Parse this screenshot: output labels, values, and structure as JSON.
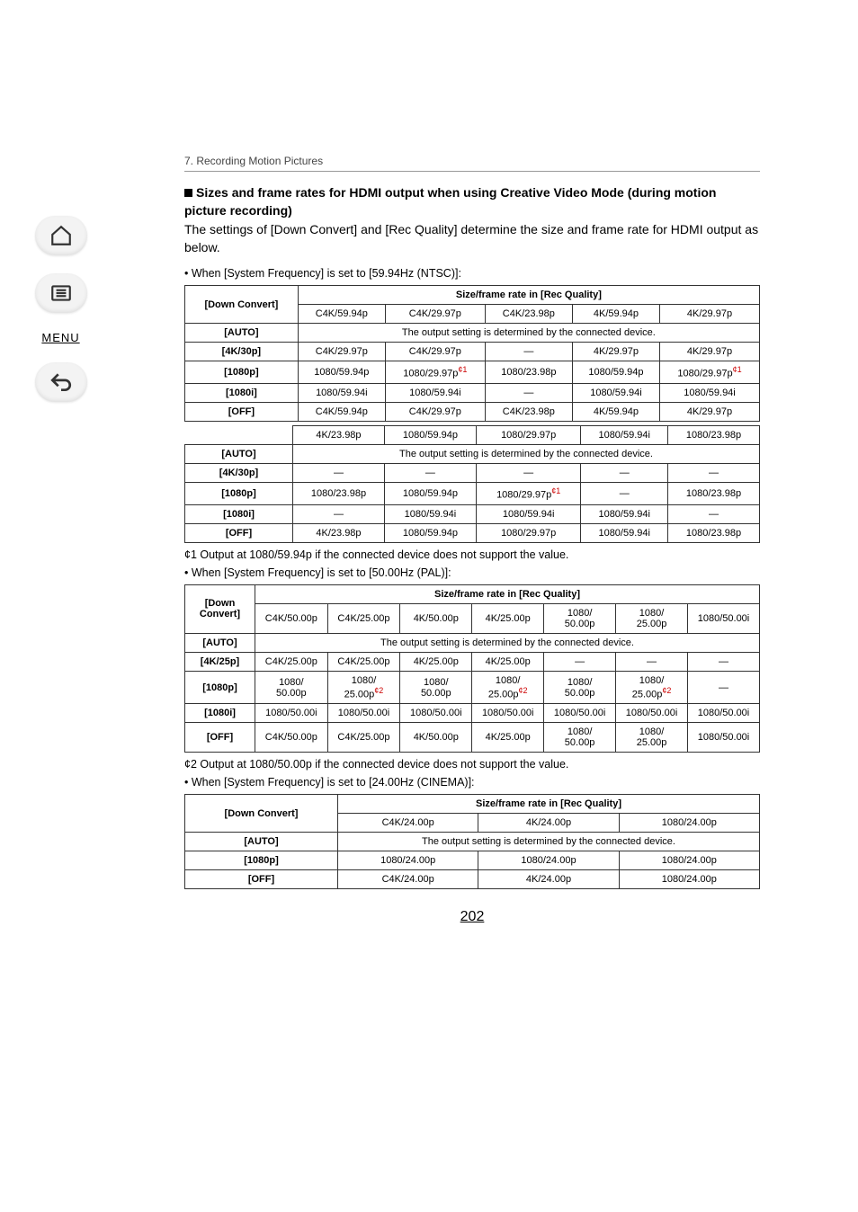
{
  "breadcrumb": "7. Recording Motion Pictures",
  "heading1": "Sizes and frame rates for HDMI output when using Creative Video Mode (during motion picture recording)",
  "body1": "The settings of [Down Convert] and [Rec Quality] determine the size and frame rate for HDMI output as below.",
  "bullet_ntsc": "• When [System Frequency] is set to [59.94Hz (NTSC)]:",
  "bullet_pal": "• When [System Frequency] is set to [50.00Hz (PAL)]:",
  "bullet_cinema": "• When [System Frequency] is set to [24.00Hz (CINEMA)]:",
  "table_head_dc": "[Down Convert]",
  "table_head_sf": "Size/frame rate in [Rec Quality]",
  "auto_label": "[AUTO]",
  "auto_msg": "The output setting is determined by the connected device.",
  "row_4k30p": "[4K/30p]",
  "row_1080p": "[1080p]",
  "row_1080i": "[1080i]",
  "row_off": "[OFF]",
  "row_4k25p": "[4K/25p]",
  "dash": "—",
  "ntsc_cols_a": [
    "C4K/59.94p",
    "C4K/29.97p",
    "C4K/23.98p",
    "4K/59.94p",
    "4K/29.97p"
  ],
  "ntsc_4k30p": [
    "C4K/29.97p",
    "C4K/29.97p",
    "—",
    "4K/29.97p",
    "4K/29.97p"
  ],
  "ntsc_1080p": [
    "1080/59.94p",
    "1080/29.97p",
    "1080/23.98p",
    "1080/59.94p",
    "1080/29.97p"
  ],
  "ntsc_1080i": [
    "1080/59.94i",
    "1080/59.94i",
    "—",
    "1080/59.94i",
    "1080/59.94i"
  ],
  "ntsc_off": [
    "C4K/59.94p",
    "C4K/29.97p",
    "C4K/23.98p",
    "4K/59.94p",
    "4K/29.97p"
  ],
  "ntsc_cols_b": [
    "4K/23.98p",
    "1080/59.94p",
    "1080/29.97p",
    "1080/59.94i",
    "1080/23.98p"
  ],
  "ntsc_b_4k30p": [
    "—",
    "—",
    "—",
    "—",
    "—"
  ],
  "ntsc_b_1080p": [
    "1080/23.98p",
    "1080/59.94p",
    "1080/29.97p",
    "—",
    "1080/23.98p"
  ],
  "ntsc_b_1080i": [
    "—",
    "1080/59.94i",
    "1080/59.94i",
    "1080/59.94i",
    "—"
  ],
  "ntsc_b_off": [
    "4K/23.98p",
    "1080/59.94p",
    "1080/29.97p",
    "1080/59.94i",
    "1080/23.98p"
  ],
  "foot1": "¢1 Output at 1080/59.94p if the connected device does not support the value.",
  "pal_head_dc": "[Down Convert]",
  "pal_cols": [
    "C4K/50.00p",
    "C4K/25.00p",
    "4K/50.00p",
    "4K/25.00p",
    "1080/\n50.00p",
    "1080/\n25.00p",
    "1080/50.00i"
  ],
  "pal_4k25p": [
    "C4K/25.00p",
    "C4K/25.00p",
    "4K/25.00p",
    "4K/25.00p",
    "—",
    "—",
    "—"
  ],
  "pal_1080p": [
    "1080/\n50.00p",
    "1080/\n25.00p",
    "1080/\n50.00p",
    "1080/\n25.00p",
    "1080/\n50.00p",
    "1080/\n25.00p",
    "—"
  ],
  "pal_1080i": [
    "1080/50.00i",
    "1080/50.00i",
    "1080/50.00i",
    "1080/50.00i",
    "1080/50.00i",
    "1080/50.00i",
    "1080/50.00i"
  ],
  "pal_off": [
    "C4K/50.00p",
    "C4K/25.00p",
    "4K/50.00p",
    "4K/25.00p",
    "1080/\n50.00p",
    "1080/\n25.00p",
    "1080/50.00i"
  ],
  "foot2": "¢2 Output at 1080/50.00p if the connected device does not support the value.",
  "cin_cols": [
    "C4K/24.00p",
    "4K/24.00p",
    "1080/24.00p"
  ],
  "cin_1080p": [
    "1080/24.00p",
    "1080/24.00p",
    "1080/24.00p"
  ],
  "cin_off": [
    "C4K/24.00p",
    "4K/24.00p",
    "1080/24.00p"
  ],
  "pagenum": "202",
  "sidebar_menu": "MENU",
  "sup1": "¢1",
  "sup2": "¢2",
  "chart_data": {
    "type": "table",
    "tables": [
      {
        "title": "System Frequency 59.94Hz (NTSC) — HDMI output size/frame rate by [Down Convert] and [Rec Quality]",
        "row_key": "[Down Convert]",
        "col_key": "Size/frame rate in [Rec Quality]",
        "columns": [
          "C4K/59.94p",
          "C4K/29.97p",
          "C4K/23.98p",
          "4K/59.94p",
          "4K/29.97p",
          "4K/23.98p",
          "1080/59.94p",
          "1080/29.97p",
          "1080/59.94i",
          "1080/23.98p"
        ],
        "rows": {
          "[AUTO]": "The output setting is determined by the connected device.",
          "[4K/30p]": [
            "C4K/29.97p",
            "C4K/29.97p",
            "—",
            "4K/29.97p",
            "4K/29.97p",
            "—",
            "—",
            "—",
            "—",
            "—"
          ],
          "[1080p]": [
            "1080/59.94p",
            "1080/29.97p¢1",
            "1080/23.98p",
            "1080/59.94p",
            "1080/29.97p¢1",
            "1080/23.98p",
            "1080/59.94p",
            "1080/29.97p¢1",
            "—",
            "1080/23.98p"
          ],
          "[1080i]": [
            "1080/59.94i",
            "1080/59.94i",
            "—",
            "1080/59.94i",
            "1080/59.94i",
            "—",
            "1080/59.94i",
            "1080/59.94i",
            "1080/59.94i",
            "—"
          ],
          "[OFF]": [
            "C4K/59.94p",
            "C4K/29.97p",
            "C4K/23.98p",
            "4K/59.94p",
            "4K/29.97p",
            "4K/23.98p",
            "1080/59.94p",
            "1080/29.97p",
            "1080/59.94i",
            "1080/23.98p"
          ]
        },
        "footnotes": {
          "¢1": "Output at 1080/59.94p if the connected device does not support the value."
        }
      },
      {
        "title": "System Frequency 50.00Hz (PAL) — HDMI output size/frame rate by [Down Convert] and [Rec Quality]",
        "row_key": "[Down Convert]",
        "col_key": "Size/frame rate in [Rec Quality]",
        "columns": [
          "C4K/50.00p",
          "C4K/25.00p",
          "4K/50.00p",
          "4K/25.00p",
          "1080/50.00p",
          "1080/25.00p",
          "1080/50.00i"
        ],
        "rows": {
          "[AUTO]": "The output setting is determined by the connected device.",
          "[4K/25p]": [
            "C4K/25.00p",
            "C4K/25.00p",
            "4K/25.00p",
            "4K/25.00p",
            "—",
            "—",
            "—"
          ],
          "[1080p]": [
            "1080/50.00p",
            "1080/25.00p¢2",
            "1080/50.00p",
            "1080/25.00p¢2",
            "1080/50.00p",
            "1080/25.00p¢2",
            "—"
          ],
          "[1080i]": [
            "1080/50.00i",
            "1080/50.00i",
            "1080/50.00i",
            "1080/50.00i",
            "1080/50.00i",
            "1080/50.00i",
            "1080/50.00i"
          ],
          "[OFF]": [
            "C4K/50.00p",
            "C4K/25.00p",
            "4K/50.00p",
            "4K/25.00p",
            "1080/50.00p",
            "1080/25.00p",
            "1080/50.00i"
          ]
        },
        "footnotes": {
          "¢2": "Output at 1080/50.00p if the connected device does not support the value."
        }
      },
      {
        "title": "System Frequency 24.00Hz (CINEMA) — HDMI output size/frame rate by [Down Convert] and [Rec Quality]",
        "row_key": "[Down Convert]",
        "col_key": "Size/frame rate in [Rec Quality]",
        "columns": [
          "C4K/24.00p",
          "4K/24.00p",
          "1080/24.00p"
        ],
        "rows": {
          "[AUTO]": "The output setting is determined by the connected device.",
          "[1080p]": [
            "1080/24.00p",
            "1080/24.00p",
            "1080/24.00p"
          ],
          "[OFF]": [
            "C4K/24.00p",
            "4K/24.00p",
            "1080/24.00p"
          ]
        }
      }
    ]
  }
}
